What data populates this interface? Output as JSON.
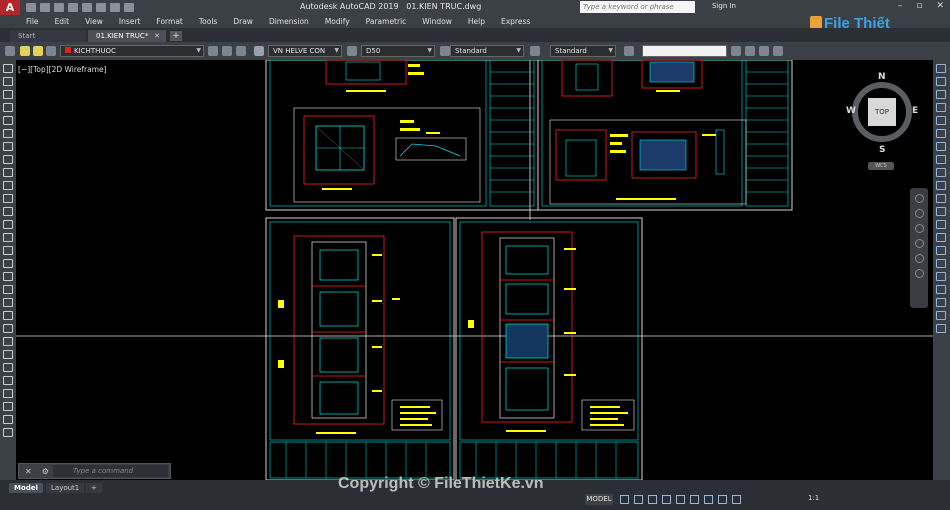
{
  "titlebar": {
    "app_name": "Autodesk AutoCAD 2019",
    "file_name": "01.KIEN TRUC.dwg",
    "search_placeholder": "Type a keyword or phrase",
    "sign_in": "Sign In"
  },
  "menu": [
    "File",
    "Edit",
    "View",
    "Insert",
    "Format",
    "Tools",
    "Draw",
    "Dimension",
    "Modify",
    "Parametric",
    "Window",
    "Help",
    "Express"
  ],
  "tabs": {
    "start": "Start",
    "active": "01.KIEN TRUC*",
    "add": "+"
  },
  "properties": {
    "layer": "KICHTHUOC",
    "text_style": "VN HELVE CON",
    "dim_style": "D50",
    "table_style": "Standard",
    "multileader_style": "Standard"
  },
  "viewport": {
    "label": "[−][Top][2D Wireframe]",
    "viewcube": {
      "n": "N",
      "s": "S",
      "w": "W",
      "e": "E",
      "top": "TOP",
      "wcs": "WCS"
    }
  },
  "command": {
    "placeholder": "Type a command"
  },
  "layout_tabs": {
    "model": "Model",
    "layout1": "Layout1",
    "add": "+"
  },
  "status": {
    "model": "MODEL",
    "scale": "1:1"
  },
  "watermark": "Copyright © FileThietKe.vn",
  "brand": "File Thiết Kế.vn",
  "colors": {
    "accent_red": "#e02020",
    "drawing_cyan": "#00e5e5",
    "drawing_yellow": "#ffff00",
    "drawing_red": "#ff2020"
  }
}
